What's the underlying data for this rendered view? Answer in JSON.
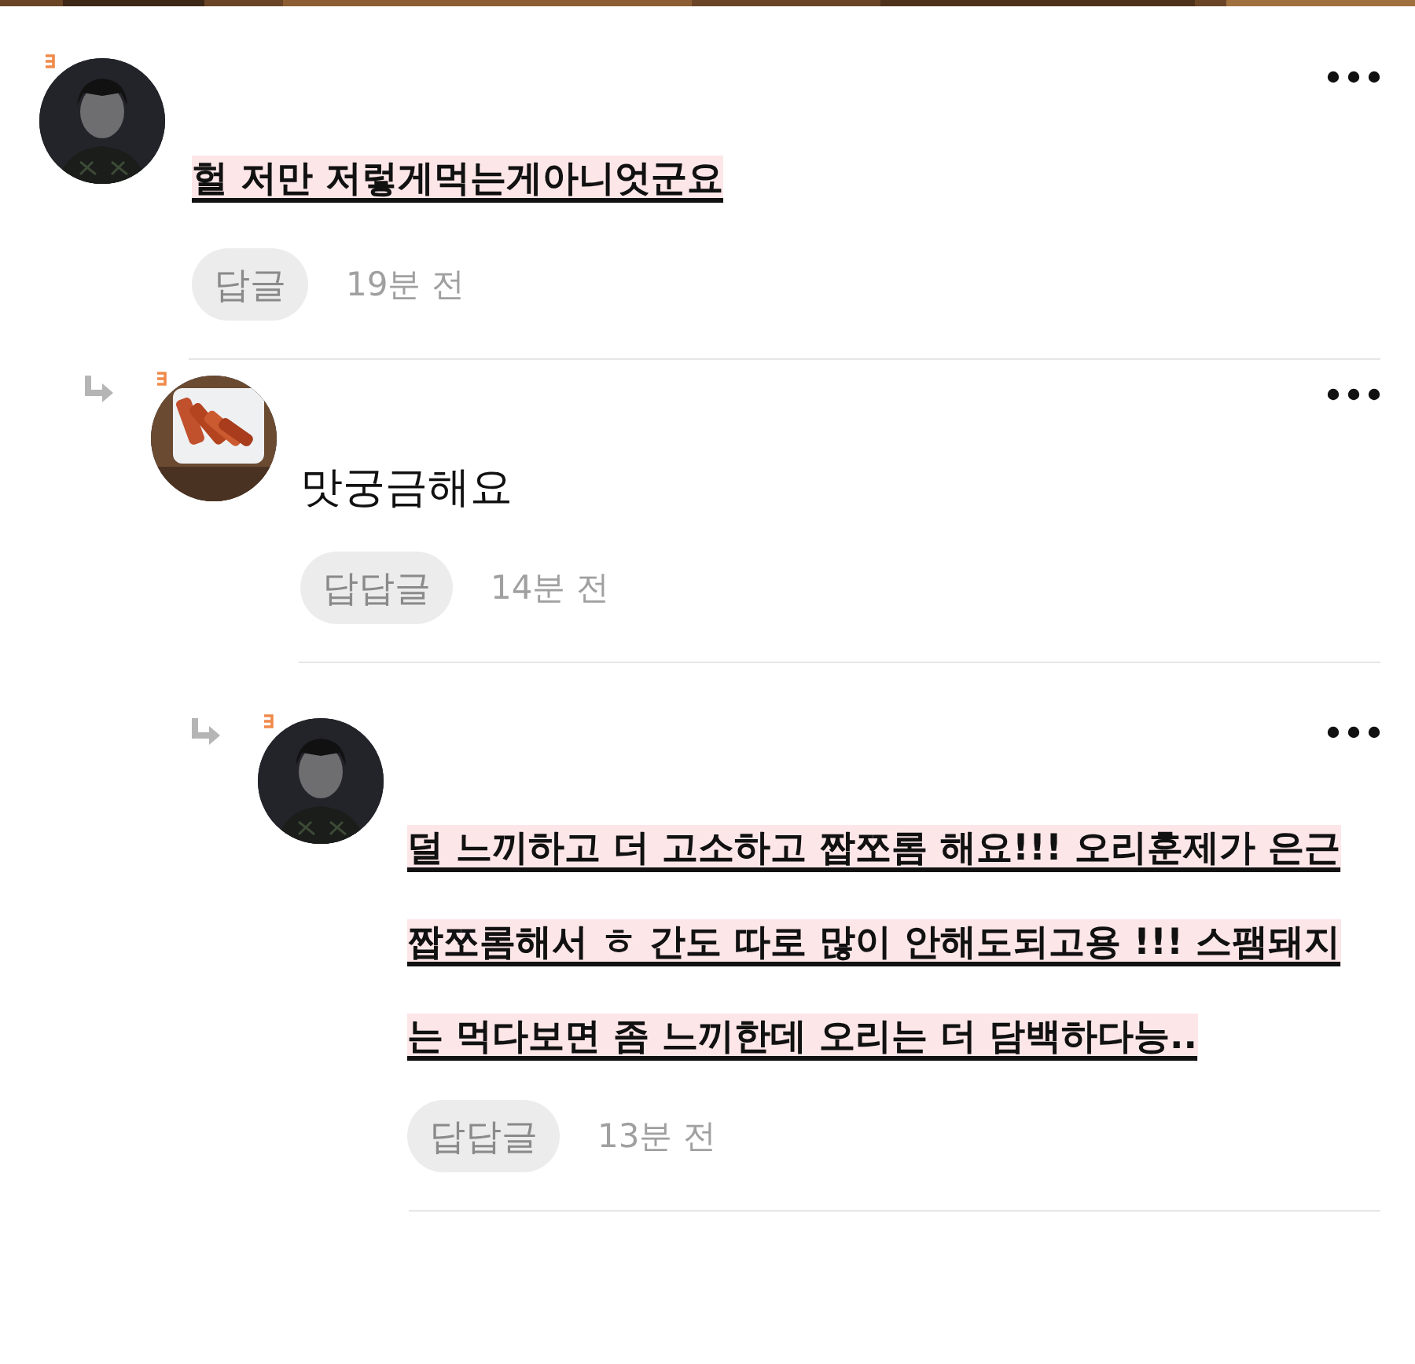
{
  "comments": [
    {
      "avatar": {
        "kind": "figure"
      },
      "text": "헐 저만 저렇게먹는게아니엇군요",
      "highlighted": true,
      "reply_label": "답글",
      "time": "19분 전",
      "children": [
        {
          "text": "맛궁금해요",
          "highlighted": false,
          "reply_label": "답답글",
          "time": "14분 전",
          "children": [
            {
              "avatar": {
                "kind": "figure"
              },
              "text": "덜 느끼하고 더 고소하고 짭쪼롬 해요!!! 오리훈제가 은근 짭쪼롬해서 ㅎ 간도 따로 많이 안해도되고용 !!! 스팸돼지는 먹다보면 좀 느끼한데 오리는 더 담백하다능..",
              "highlighted": true,
              "reply_label": "답답글",
              "time": "13분 전"
            }
          ]
        }
      ]
    }
  ]
}
